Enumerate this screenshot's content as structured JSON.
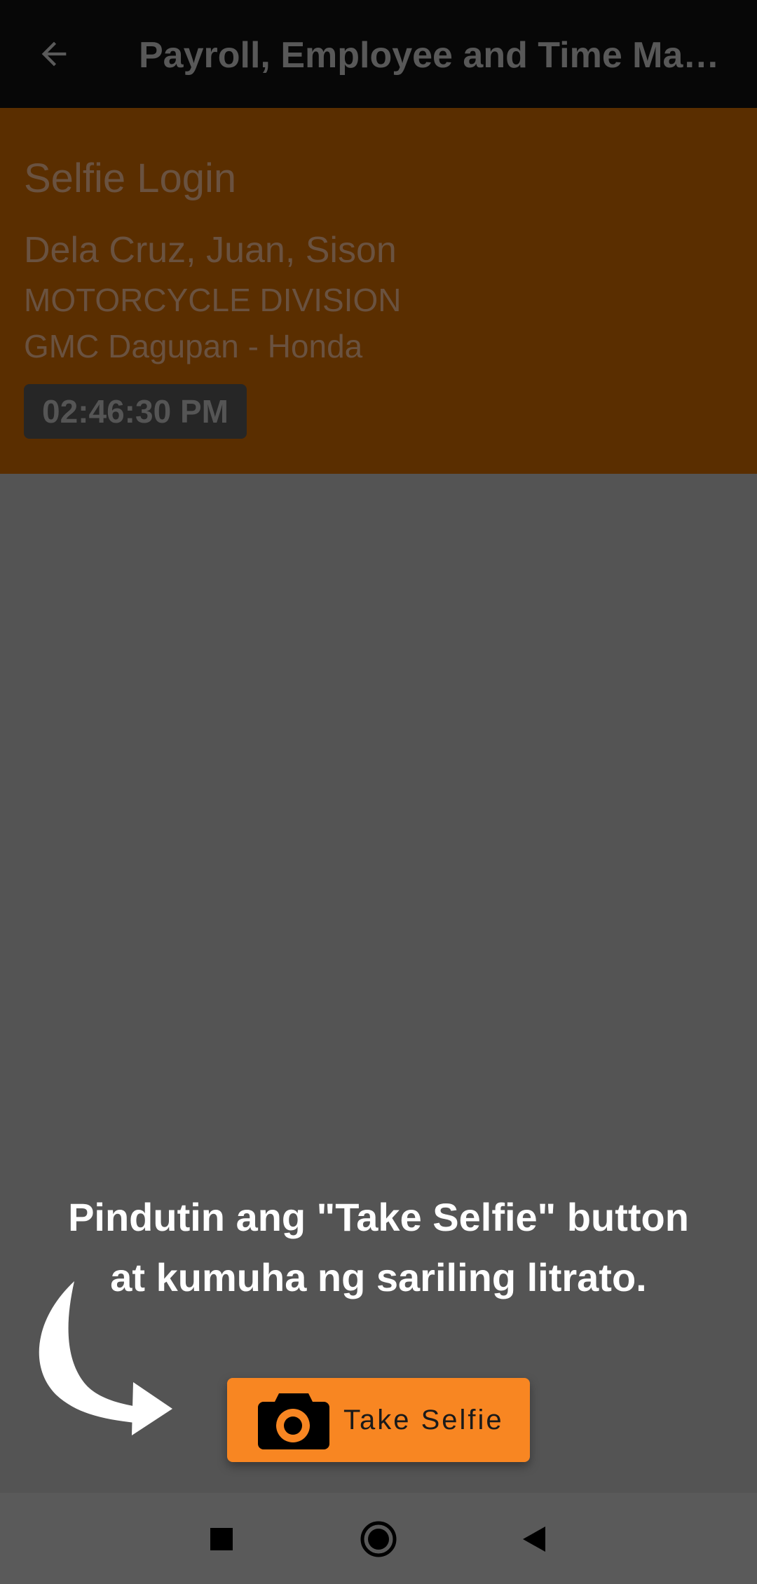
{
  "appbar": {
    "back_icon": "arrow-left-icon",
    "title": "Payroll, Employee and Time Management"
  },
  "header": {
    "screen_title": "Selfie Login",
    "employee_name": "Dela Cruz, Juan, Sison",
    "division": "MOTORCYCLE DIVISION",
    "branch": "GMC Dagupan - Honda",
    "clock": "02:46:30 PM",
    "background_color": "#5a2e00"
  },
  "tutorial": {
    "hint_line1": "Pindutin ang \"Take Selfie\" button",
    "hint_line2": "at kumuha ng sariling litrato.",
    "arrow_icon": "curved-arrow-icon"
  },
  "take_selfie": {
    "icon": "camera-icon",
    "label": "Take Selfie",
    "color": "#f88622"
  },
  "navbar": {
    "recents_icon": "square-icon",
    "home_icon": "circle-icon",
    "back_icon": "triangle-back-icon"
  }
}
